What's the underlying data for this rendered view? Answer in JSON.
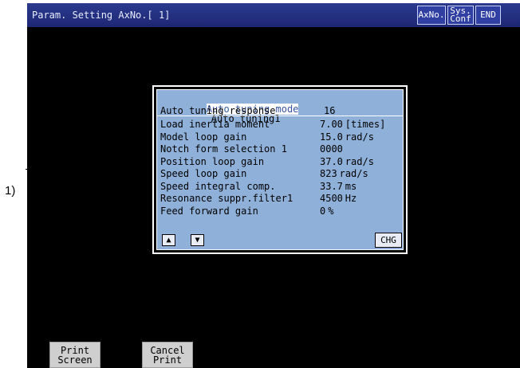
{
  "callout": {
    "label": "1)"
  },
  "titlebar": {
    "title": "Param. Setting AxNo.[ 1]",
    "axno_label": "AxNo.",
    "sys_conf_line1": "Sys.",
    "sys_conf_line2": "Conf",
    "end_label": "END"
  },
  "panel": {
    "mode_label": "Auto tuning mode",
    "mode_value": "Auto tuning1",
    "rows": [
      {
        "label": "Auto tuning response",
        "value": "16",
        "unit": ""
      },
      {
        "label": "Load inertia moment",
        "value": "7.00",
        "unit": "[times]"
      },
      {
        "label": "Model loop gain",
        "value": "15.0",
        "unit": "rad/s"
      },
      {
        "label": "Notch form selection 1",
        "value": "0000",
        "unit": ""
      },
      {
        "label": "Position loop gain",
        "value": "37.0",
        "unit": "rad/s"
      },
      {
        "label": "Speed loop gain",
        "value": "823",
        "unit": "rad/s"
      },
      {
        "label": "Speed integral comp.",
        "value": "33.7",
        "unit": "ms"
      },
      {
        "label": "Resonance suppr.filter1",
        "value": "4500",
        "unit": "Hz"
      },
      {
        "label": "Feed forward gain",
        "value": "0",
        "unit": "%"
      }
    ],
    "up_arrow": "▲",
    "down_arrow": "▼",
    "chg_label": "CHG"
  },
  "bottom": {
    "print_screen_line1": "Print",
    "print_screen_line2": "Screen",
    "cancel_print_line1": "Cancel",
    "cancel_print_line2": "Print"
  }
}
